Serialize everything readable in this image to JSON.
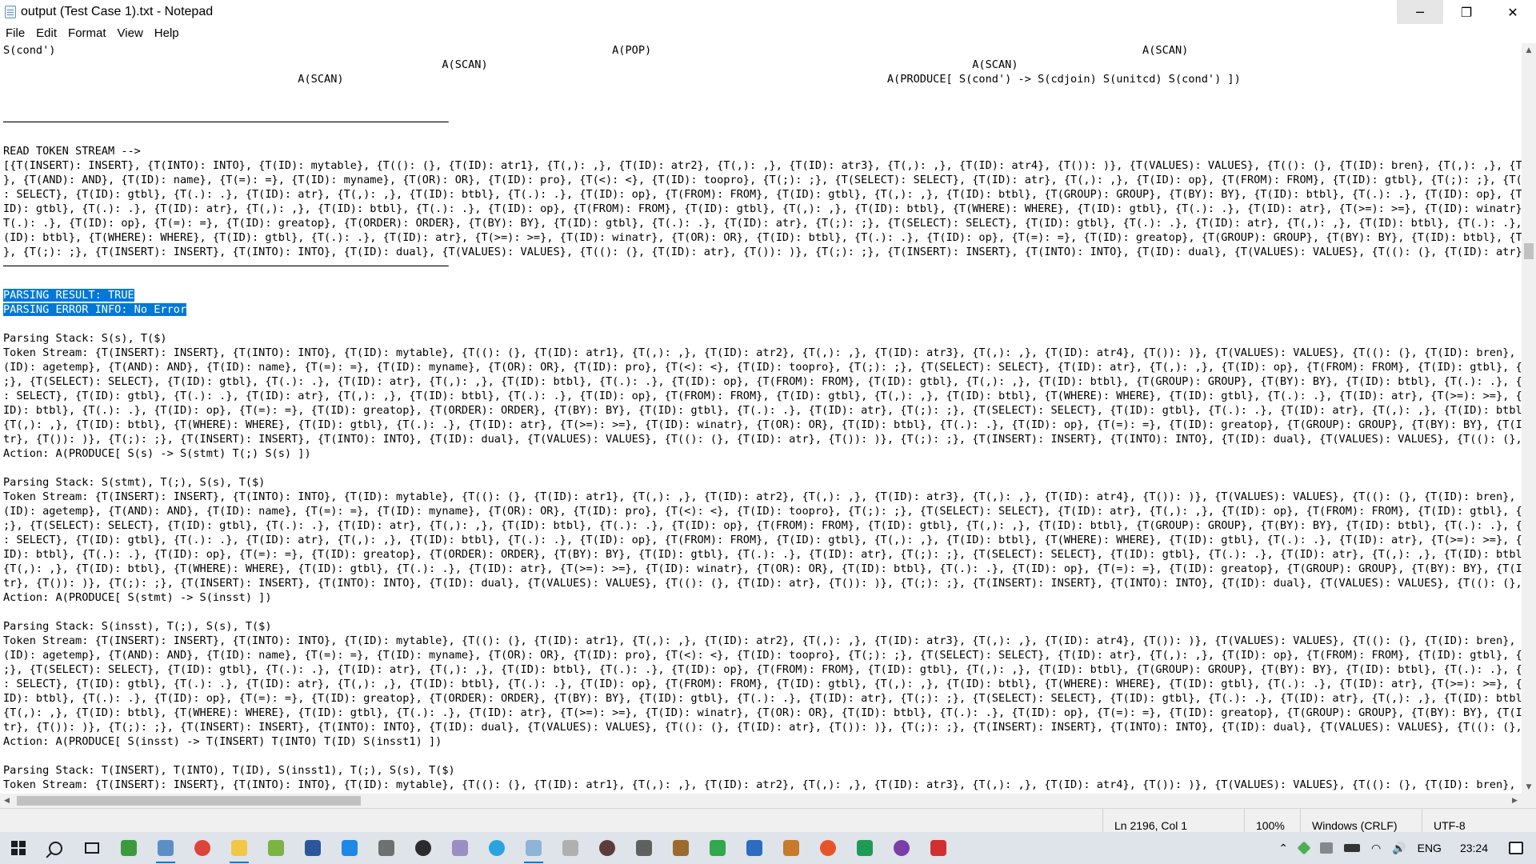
{
  "window": {
    "title": "output (Test Case 1).txt - Notepad",
    "controls": {
      "minimize": "─",
      "restore": "❐",
      "close": "✕"
    }
  },
  "menu": [
    "File",
    "Edit",
    "Format",
    "View",
    "Help"
  ],
  "document": {
    "lines": [
      "S(cond')                                                                                     A(POP)                                                                           A(SCAN)",
      "                                                                   A(SCAN)                                                                          A(SCAN)",
      "                                             A(SCAN)                                                                                   A(PRODUCE[ S(cond') -> S(cdjoin) S(unitcd) S(cond') ])",
      "",
      "",
      "────────────────────────────────────────────────────────────────────",
      "",
      "READ TOKEN STREAM -->",
      "[{T(INSERT): INSERT}, {T(INTO): INTO}, {T(ID): mytable}, {T((): (}, {T(ID): atr1}, {T(,): ,}, {T(ID): atr2}, {T(,): ,}, {T(ID): atr3}, {T(,): ,}, {T(ID): atr4}, {T()): )}, {T(VALUES): VALUES}, {T((): (}, {T(ID): bren}, {T(,): ,}, {T(ID):",
      "}, {T(AND): AND}, {T(ID): name}, {T(=): =}, {T(ID): myname}, {T(OR): OR}, {T(ID): pro}, {T(<): <}, {T(ID): toopro}, {T(;): ;}, {T(SELECT): SELECT}, {T(ID): atr}, {T(,): ,}, {T(ID): op}, {T(FROM): FROM}, {T(ID): gtbl}, {T(;): ;}, {T(SELEC",
      ": SELECT}, {T(ID): gtbl}, {T(.): .}, {T(ID): atr}, {T(,): ,}, {T(ID): btbl}, {T(.): .}, {T(ID): op}, {T(FROM): FROM}, {T(ID): gtbl}, {T(,): ,}, {T(ID): btbl}, {T(GROUP): GROUP}, {T(BY): BY}, {T(ID): btbl}, {T(.): .}, {T(ID): op}, {T(;):",
      "ID): gtbl}, {T(.): .}, {T(ID): atr}, {T(,): ,}, {T(ID): btbl}, {T(.): .}, {T(ID): op}, {T(FROM): FROM}, {T(ID): gtbl}, {T(,): ,}, {T(ID): btbl}, {T(WHERE): WHERE}, {T(ID): gtbl}, {T(.): .}, {T(ID): atr}, {T(>=): >=}, {T(ID): winatr}, {T",
      "T(.): .}, {T(ID): op}, {T(=): =}, {T(ID): greatop}, {T(ORDER): ORDER}, {T(BY): BY}, {T(ID): gtbl}, {T(.): .}, {T(ID): atr}, {T(;): ;}, {T(SELECT): SELECT}, {T(ID): gtbl}, {T(.): .}, {T(ID): atr}, {T(,): ,}, {T(ID): btbl}, {T(.): .}, {T(I",
      "(ID): btbl}, {T(WHERE): WHERE}, {T(ID): gtbl}, {T(.): .}, {T(ID): atr}, {T(>=): >=}, {T(ID): winatr}, {T(OR): OR}, {T(ID): btbl}, {T(.): .}, {T(ID): op}, {T(=): =}, {T(ID): greatop}, {T(GROUP): GROUP}, {T(BY): BY}, {T(ID): btbl}, {T(.):",
      "}, {T(;): ;}, {T(INSERT): INSERT}, {T(INTO): INTO}, {T(ID): dual}, {T(VALUES): VALUES}, {T((): (}, {T(ID): atr}, {T()): )}, {T(;): ;}, {T(INSERT): INSERT}, {T(INTO): INTO}, {T(ID): dual}, {T(VALUES): VALUES}, {T((): (}, {T(ID): atr}, {T(",
      "────────────────────────────────────────────────────────────────────",
      "",
      "PARSING RESULT: TRUE",
      "PARSING ERROR INFO: No Error",
      "",
      "Parsing Stack: S(s), T($)",
      "Token Stream: {T(INSERT): INSERT}, {T(INTO): INTO}, {T(ID): mytable}, {T((): (}, {T(ID): atr1}, {T(,): ,}, {T(ID): atr2}, {T(,): ,}, {T(ID): atr3}, {T(,): ,}, {T(ID): atr4}, {T()): )}, {T(VALUES): VALUES}, {T((): (}, {T(ID): bren}, {T(,",
      "(ID): agetemp}, {T(AND): AND}, {T(ID): name}, {T(=): =}, {T(ID): myname}, {T(OR): OR}, {T(ID): pro}, {T(<): <}, {T(ID): toopro}, {T(;): ;}, {T(SELECT): SELECT}, {T(ID): atr}, {T(,): ,}, {T(ID): op}, {T(FROM): FROM}, {T(ID): gtbl}, {T(;):",
      ";}, {T(SELECT): SELECT}, {T(ID): gtbl}, {T(.): .}, {T(ID): atr}, {T(,): ,}, {T(ID): btbl}, {T(.): .}, {T(ID): op}, {T(FROM): FROM}, {T(ID): gtbl}, {T(,): ,}, {T(ID): btbl}, {T(GROUP): GROUP}, {T(BY): BY}, {T(ID): btbl}, {T(.): .}, {T(ID",
      ": SELECT}, {T(ID): gtbl}, {T(.): .}, {T(ID): atr}, {T(,): ,}, {T(ID): btbl}, {T(.): .}, {T(ID): op}, {T(FROM): FROM}, {T(ID): gtbl}, {T(,): ,}, {T(ID): btbl}, {T(WHERE): WHERE}, {T(ID): gtbl}, {T(.): .}, {T(ID): atr}, {T(>=): >=}, {T(ID",
      "ID): btbl}, {T(.): .}, {T(ID): op}, {T(=): =}, {T(ID): greatop}, {T(ORDER): ORDER}, {T(BY): BY}, {T(ID): gtbl}, {T(.): .}, {T(ID): atr}, {T(;): ;}, {T(SELECT): SELECT}, {T(ID): gtbl}, {T(.): .}, {T(ID): atr}, {T(,): ,}, {T(ID): btbl}, {T",
      "{T(,): ,}, {T(ID): btbl}, {T(WHERE): WHERE}, {T(ID): gtbl}, {T(.): .}, {T(ID): atr}, {T(>=): >=}, {T(ID): winatr}, {T(OR): OR}, {T(ID): btbl}, {T(.): .}, {T(ID): op}, {T(=): =}, {T(ID): greatop}, {T(GROUP): GROUP}, {T(BY): BY}, {T(ID): b",
      "tr}, {T()): )}, {T(;): ;}, {T(INSERT): INSERT}, {T(INTO): INTO}, {T(ID): dual}, {T(VALUES): VALUES}, {T((): (}, {T(ID): atr}, {T()): )}, {T(;): ;}, {T(INSERT): INSERT}, {T(INTO): INTO}, {T(ID): dual}, {T(VALUES): VALUES}, {T((): (}, {T(I",
      "Action: A(PRODUCE[ S(s) -> S(stmt) T(;) S(s) ])",
      "",
      "Parsing Stack: S(stmt), T(;), S(s), T($)",
      "Token Stream: {T(INSERT): INSERT}, {T(INTO): INTO}, {T(ID): mytable}, {T((): (}, {T(ID): atr1}, {T(,): ,}, {T(ID): atr2}, {T(,): ,}, {T(ID): atr3}, {T(,): ,}, {T(ID): atr4}, {T()): )}, {T(VALUES): VALUES}, {T((): (}, {T(ID): bren}, {T(,",
      "(ID): agetemp}, {T(AND): AND}, {T(ID): name}, {T(=): =}, {T(ID): myname}, {T(OR): OR}, {T(ID): pro}, {T(<): <}, {T(ID): toopro}, {T(;): ;}, {T(SELECT): SELECT}, {T(ID): atr}, {T(,): ,}, {T(ID): op}, {T(FROM): FROM}, {T(ID): gtbl}, {T(;):",
      ";}, {T(SELECT): SELECT}, {T(ID): gtbl}, {T(.): .}, {T(ID): atr}, {T(,): ,}, {T(ID): btbl}, {T(.): .}, {T(ID): op}, {T(FROM): FROM}, {T(ID): gtbl}, {T(,): ,}, {T(ID): btbl}, {T(GROUP): GROUP}, {T(BY): BY}, {T(ID): btbl}, {T(.): .}, {T(ID",
      ": SELECT}, {T(ID): gtbl}, {T(.): .}, {T(ID): atr}, {T(,): ,}, {T(ID): btbl}, {T(.): .}, {T(ID): op}, {T(FROM): FROM}, {T(ID): gtbl}, {T(,): ,}, {T(ID): btbl}, {T(WHERE): WHERE}, {T(ID): gtbl}, {T(.): .}, {T(ID): atr}, {T(>=): >=}, {T(ID",
      "ID): btbl}, {T(.): .}, {T(ID): op}, {T(=): =}, {T(ID): greatop}, {T(ORDER): ORDER}, {T(BY): BY}, {T(ID): gtbl}, {T(.): .}, {T(ID): atr}, {T(;): ;}, {T(SELECT): SELECT}, {T(ID): gtbl}, {T(.): .}, {T(ID): atr}, {T(,): ,}, {T(ID): btbl}, {T",
      "{T(,): ,}, {T(ID): btbl}, {T(WHERE): WHERE}, {T(ID): gtbl}, {T(.): .}, {T(ID): atr}, {T(>=): >=}, {T(ID): winatr}, {T(OR): OR}, {T(ID): btbl}, {T(.): .}, {T(ID): op}, {T(=): =}, {T(ID): greatop}, {T(GROUP): GROUP}, {T(BY): BY}, {T(ID): b",
      "tr}, {T()): )}, {T(;): ;}, {T(INSERT): INSERT}, {T(INTO): INTO}, {T(ID): dual}, {T(VALUES): VALUES}, {T((): (}, {T(ID): atr}, {T()): )}, {T(;): ;}, {T(INSERT): INSERT}, {T(INTO): INTO}, {T(ID): dual}, {T(VALUES): VALUES}, {T((): (}, {T(I",
      "Action: A(PRODUCE[ S(stmt) -> S(insst) ])",
      "",
      "Parsing Stack: S(insst), T(;), S(s), T($)",
      "Token Stream: {T(INSERT): INSERT}, {T(INTO): INTO}, {T(ID): mytable}, {T((): (}, {T(ID): atr1}, {T(,): ,}, {T(ID): atr2}, {T(,): ,}, {T(ID): atr3}, {T(,): ,}, {T(ID): atr4}, {T()): )}, {T(VALUES): VALUES}, {T((): (}, {T(ID): bren}, {T(,",
      "(ID): agetemp}, {T(AND): AND}, {T(ID): name}, {T(=): =}, {T(ID): myname}, {T(OR): OR}, {T(ID): pro}, {T(<): <}, {T(ID): toopro}, {T(;): ;}, {T(SELECT): SELECT}, {T(ID): atr}, {T(,): ,}, {T(ID): op}, {T(FROM): FROM}, {T(ID): gtbl}, {T(;):",
      ";}, {T(SELECT): SELECT}, {T(ID): gtbl}, {T(.): .}, {T(ID): atr}, {T(,): ,}, {T(ID): btbl}, {T(.): .}, {T(ID): op}, {T(FROM): FROM}, {T(ID): gtbl}, {T(,): ,}, {T(ID): btbl}, {T(GROUP): GROUP}, {T(BY): BY}, {T(ID): btbl}, {T(.): .}, {T(ID",
      ": SELECT}, {T(ID): gtbl}, {T(.): .}, {T(ID): atr}, {T(,): ,}, {T(ID): btbl}, {T(.): .}, {T(ID): op}, {T(FROM): FROM}, {T(ID): gtbl}, {T(,): ,}, {T(ID): btbl}, {T(WHERE): WHERE}, {T(ID): gtbl}, {T(.): .}, {T(ID): atr}, {T(>=): >=}, {T(ID",
      "ID): btbl}, {T(.): .}, {T(ID): op}, {T(=): =}, {T(ID): greatop}, {T(ORDER): ORDER}, {T(BY): BY}, {T(ID): gtbl}, {T(.): .}, {T(ID): atr}, {T(;): ;}, {T(SELECT): SELECT}, {T(ID): gtbl}, {T(.): .}, {T(ID): atr}, {T(,): ,}, {T(ID): btbl}, {T",
      "{T(,): ,}, {T(ID): btbl}, {T(WHERE): WHERE}, {T(ID): gtbl}, {T(.): .}, {T(ID): atr}, {T(>=): >=}, {T(ID): winatr}, {T(OR): OR}, {T(ID): btbl}, {T(.): .}, {T(ID): op}, {T(=): =}, {T(ID): greatop}, {T(GROUP): GROUP}, {T(BY): BY}, {T(ID): b",
      "tr}, {T()): )}, {T(;): ;}, {T(INSERT): INSERT}, {T(INTO): INTO}, {T(ID): dual}, {T(VALUES): VALUES}, {T((): (}, {T(ID): atr}, {T()): )}, {T(;): ;}, {T(INSERT): INSERT}, {T(INTO): INTO}, {T(ID): dual}, {T(VALUES): VALUES}, {T((): (}, {T(I",
      "Action: A(PRODUCE[ S(insst) -> T(INSERT) T(INTO) T(ID) S(insst1) ])",
      "",
      "Parsing Stack: T(INSERT), T(INTO), T(ID), S(insst1), T(;), S(s), T($)",
      "Token Stream: {T(INSERT): INSERT}, {T(INTO): INTO}, {T(ID): mytable}, {T((): (}, {T(ID): atr1}, {T(,): ,}, {T(ID): atr2}, {T(,): ,}, {T(ID): atr3}, {T(,): ,}, {T(ID): atr4}, {T()): )}, {T(VALUES): VALUES}, {T((): (}, {T(ID): bren}, {T(,",
      "(ID): agetemp}, {T(AND): AND}, {T(ID): name}, {T(=): =}, {T(ID): myname}, {T(OR): OR}, {T(ID): pro}, {T(<): <}, {T(ID): toopro}, {T(;): ;}, {T(SELECT): SELECT}, {T(ID): atr}, {T(,): ,}, {T(ID): op}, {T(FROM): FROM}, {T(ID): gtbl}, {T(;):"
    ],
    "selected_lines": [
      17,
      18
    ]
  },
  "status": {
    "position": "Ln 2196, Col 1",
    "zoom": "100%",
    "line_ending": "Windows (CRLF)",
    "encoding": "UTF-8"
  },
  "taskbar": {
    "apps": [
      {
        "name": "start-button",
        "icon": "windows-logo-icon",
        "active": false
      },
      {
        "name": "search-button",
        "icon": "search-icon",
        "active": false
      },
      {
        "name": "task-view-button",
        "icon": "task-view-icon",
        "active": false
      },
      {
        "name": "taskbar-app-1",
        "icon": "green-app-icon",
        "color": "#3c9a3c",
        "active": false
      },
      {
        "name": "taskbar-app-2",
        "icon": "monitor-app-icon",
        "color": "#5a8fc7",
        "active": true
      },
      {
        "name": "taskbar-chrome",
        "icon": "chrome-icon",
        "color": "#db4437",
        "active": false
      },
      {
        "name": "taskbar-file-explorer",
        "icon": "folder-icon",
        "color": "#f2c744",
        "active": true
      },
      {
        "name": "taskbar-app-3",
        "icon": "colorful-app-icon",
        "color": "#7cb342",
        "active": false
      },
      {
        "name": "taskbar-word",
        "icon": "word-icon",
        "color": "#2b579a",
        "active": false
      },
      {
        "name": "taskbar-vscode",
        "icon": "vscode-icon",
        "color": "#1e88e5",
        "active": false
      },
      {
        "name": "taskbar-calculator",
        "icon": "calculator-icon",
        "color": "#707070",
        "active": false
      },
      {
        "name": "taskbar-app-4",
        "icon": "dark-circle-icon",
        "color": "#2b2b2b",
        "active": false
      },
      {
        "name": "taskbar-app-5",
        "icon": "feather-icon",
        "color": "#9a8fc0",
        "active": false
      },
      {
        "name": "taskbar-telegram",
        "icon": "telegram-icon",
        "color": "#2aa3df",
        "active": false
      },
      {
        "name": "taskbar-notepad",
        "icon": "notepad-icon",
        "color": "#8fb4d9",
        "active": true
      },
      {
        "name": "taskbar-app-6",
        "icon": "pen-icon",
        "color": "#b0b0b0",
        "active": false
      },
      {
        "name": "taskbar-app-7",
        "icon": "disc-icon",
        "color": "#5c3b3b",
        "active": false
      },
      {
        "name": "taskbar-app-8",
        "icon": "bracket-icon",
        "color": "#606060",
        "active": false
      },
      {
        "name": "taskbar-app-9",
        "icon": "brown-box-icon",
        "color": "#9a6b2b",
        "active": false
      },
      {
        "name": "taskbar-app-10",
        "icon": "green-box-icon",
        "color": "#2fa84f",
        "active": false
      },
      {
        "name": "taskbar-app-11",
        "icon": "blue-app-icon",
        "color": "#2d6cc0",
        "active": false
      },
      {
        "name": "taskbar-app-12",
        "icon": "hd-icon",
        "color": "#c77a2a",
        "active": false
      },
      {
        "name": "taskbar-brave",
        "icon": "brave-icon",
        "color": "#e8542a",
        "active": false
      },
      {
        "name": "taskbar-app-13",
        "icon": "leaf-icon",
        "color": "#1f9b58",
        "active": false
      },
      {
        "name": "taskbar-app-14",
        "icon": "purple-circle-icon",
        "color": "#7a3ea8",
        "active": false
      },
      {
        "name": "taskbar-acrobat",
        "icon": "acrobat-icon",
        "color": "#d32f2f",
        "active": false
      }
    ],
    "tray": {
      "language": "ENG",
      "time": "23:24"
    }
  }
}
